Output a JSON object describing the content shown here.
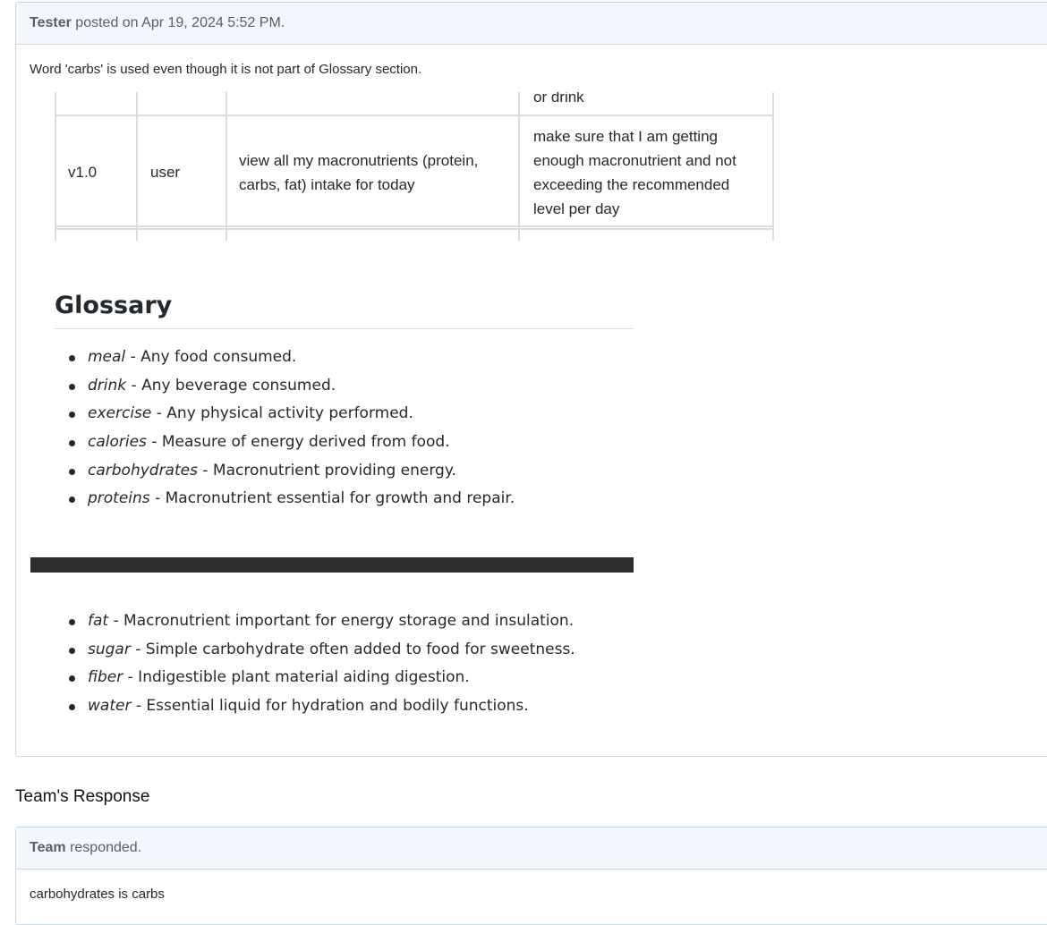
{
  "issue": {
    "author": "Tester",
    "meta": "posted on Apr 19, 2024 5:52 PM.",
    "description": "Word 'carbs' is used even though it is not part of Glossary section."
  },
  "screenshot": {
    "table": {
      "partial_top_text": "or drink",
      "row": {
        "version": "v1.0",
        "role": "user",
        "feature": [
          "view all my macronutrients (protein,",
          "carbs, fat) intake for today"
        ],
        "benefit": [
          "make sure that I am getting",
          "enough macronutrient and not",
          "exceeding the recommended",
          "level per day"
        ]
      }
    },
    "glossary_title": "Glossary",
    "glossary_items": [
      {
        "term": "meal",
        "def": " - Any food consumed."
      },
      {
        "term": "drink",
        "def": " - Any beverage consumed."
      },
      {
        "term": "exercise",
        "def": " - Any physical activity performed."
      },
      {
        "term": "calories",
        "def": " - Measure of energy derived from food."
      },
      {
        "term": "carbohydrates",
        "def": " - Macronutrient providing energy."
      },
      {
        "term": "proteins",
        "def": " - Macronutrient essential for growth and repair."
      }
    ],
    "glossary_items_2": [
      {
        "term": "fat",
        "def": " - Macronutrient important for energy storage and insulation."
      },
      {
        "term": "sugar",
        "def": " - Simple carbohydrate often added to food for sweetness."
      },
      {
        "term": "fiber",
        "def": " - Indigestible plant material aiding digestion."
      },
      {
        "term": "water",
        "def": " - Essential liquid for hydration and bodily functions."
      }
    ]
  },
  "response_section": {
    "title": "Team's Response",
    "author": "Team",
    "meta": "responded.",
    "text": "carbohydrates is carbs"
  }
}
